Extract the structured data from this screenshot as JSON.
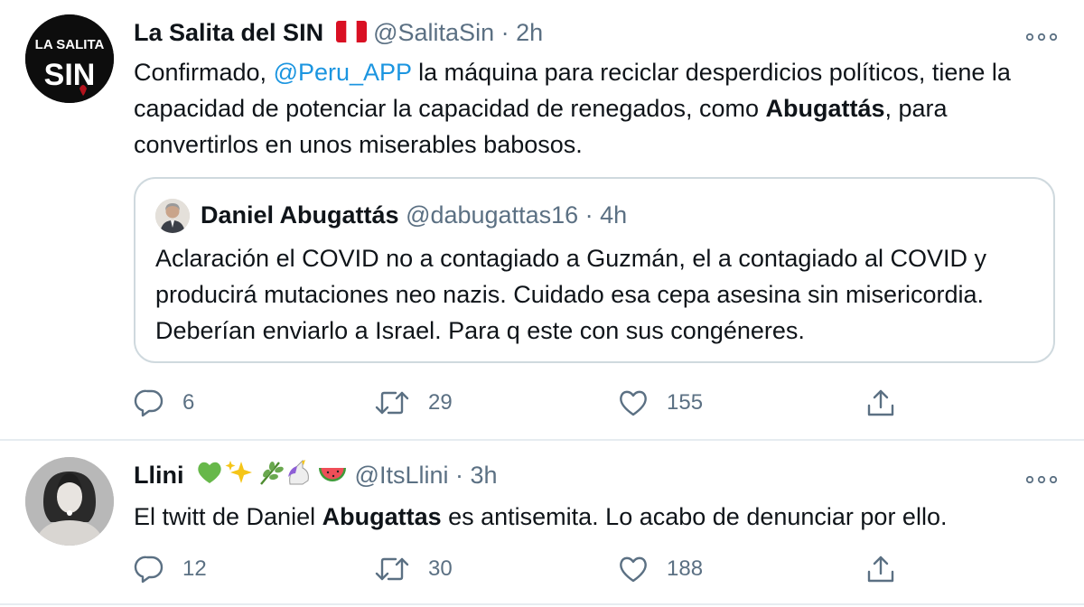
{
  "tweets": [
    {
      "display_name": "La Salita del SIN",
      "flag_emoji": "🇵🇪",
      "handle": "@SalitaSin",
      "separator": "·",
      "time": "2h",
      "avatar_text": [
        "LA SALITA",
        "SIN"
      ],
      "body": {
        "p1": "Confirmado, ",
        "mention": "@Peru_APP",
        "p2": "  la máquina para reciclar desperdicios políticos, tiene la capacidad de potenciar la capacidad de renegados, como ",
        "bold": "Abugattás",
        "p3": ", para convertirlos en unos miserables babosos."
      },
      "quote": {
        "display_name": "Daniel Abugattás",
        "handle": "@dabugattas16",
        "separator": "·",
        "time": "4h",
        "text": "Aclaración el COVID no a contagiado a Guzmán, el a contagiado al COVID y producirá mutaciones neo nazis. Cuidado esa cepa asesina sin misericordia. Deberían enviarlo a Israel. Para q este con sus congéneres."
      },
      "actions": {
        "replies": "6",
        "retweets": "29",
        "likes": "155"
      }
    },
    {
      "display_name": "Llini",
      "name_emojis": "💚✨🌿🦄🍉",
      "handle": "@ItsLlini",
      "separator": "·",
      "time": "3h",
      "body": {
        "p1": "El twitt de Daniel ",
        "bold": "Abugattas",
        "p2": " es antisemita. Lo acabo de denunciar por ello."
      },
      "actions": {
        "replies": "12",
        "retweets": "30",
        "likes": "188"
      }
    }
  ],
  "colors": {
    "text": "#0f1419",
    "secondary": "#5b7083",
    "link": "#1b95e0",
    "border": "#cfd9de",
    "divider": "#e6ecf0",
    "flag_red": "#d91023"
  },
  "icons": [
    "reply-icon",
    "retweet-icon",
    "like-icon",
    "share-icon",
    "more-options-icon"
  ]
}
